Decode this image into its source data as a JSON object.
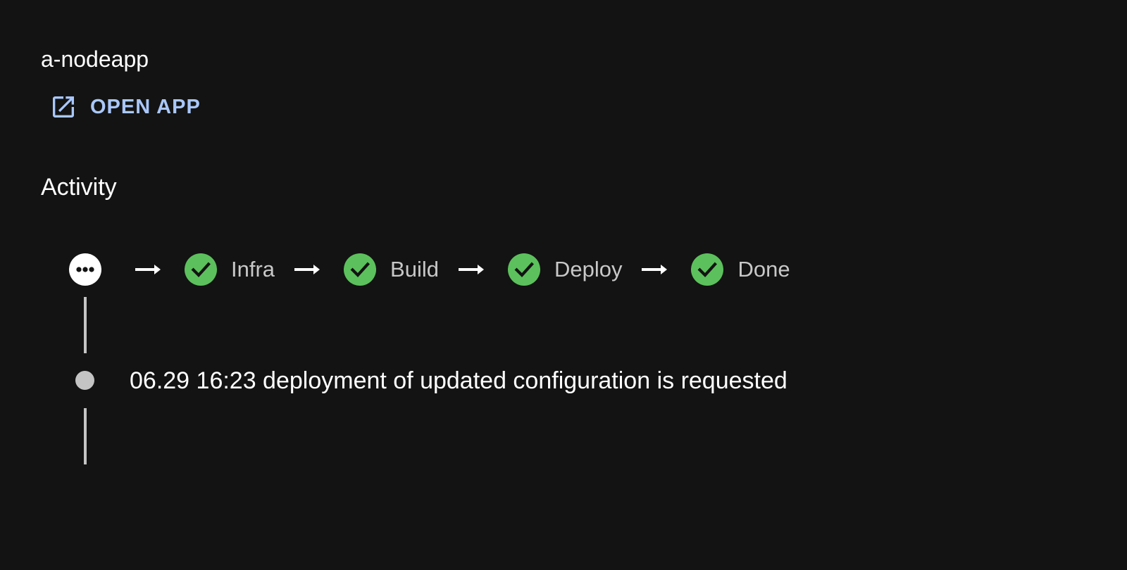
{
  "app": {
    "title": "a-nodeapp",
    "open_app_label": "OPEN APP",
    "open_app_icon": "open-in-new-icon"
  },
  "activity": {
    "title": "Activity",
    "pipeline": {
      "status_icon": "more-horiz-icon",
      "steps": [
        {
          "label": "Infra",
          "status": "done",
          "icon": "check-circle-icon"
        },
        {
          "label": "Build",
          "status": "done",
          "icon": "check-circle-icon"
        },
        {
          "label": "Deploy",
          "status": "done",
          "icon": "check-circle-icon"
        },
        {
          "label": "Done",
          "status": "done",
          "icon": "check-circle-icon"
        }
      ]
    },
    "events": [
      {
        "text": "06.29 16:23 deployment of updated configuration is requested"
      }
    ]
  },
  "colors": {
    "background": "#131313",
    "link": "#a9c7fa",
    "success": "#5cc15c",
    "timeline": "#c4c4c4",
    "step_label": "#c8c8c8"
  }
}
